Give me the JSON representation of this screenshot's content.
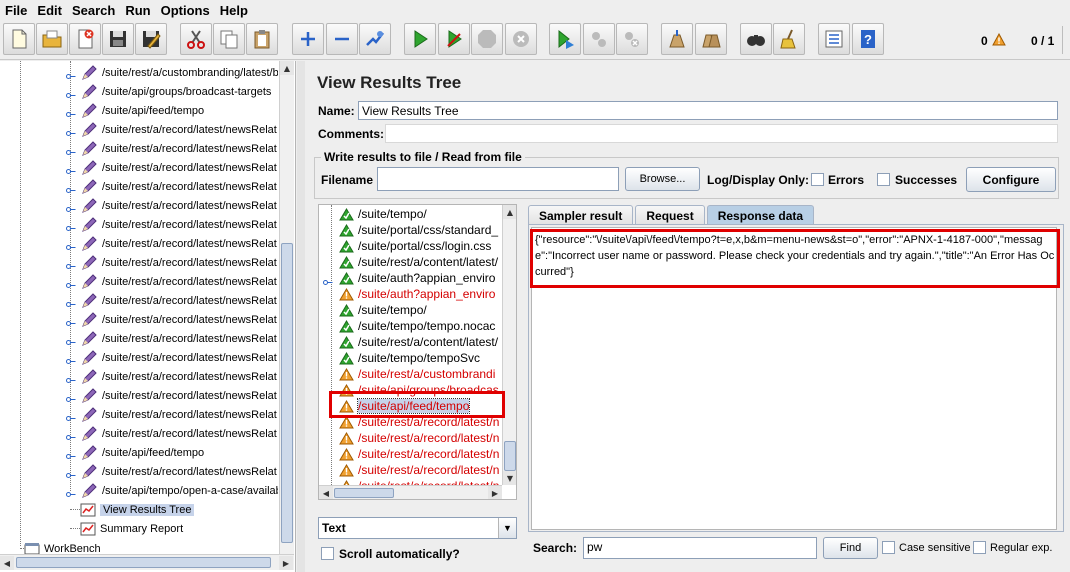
{
  "menubar": {
    "items": [
      "File",
      "Edit",
      "Search",
      "Run",
      "Options",
      "Help"
    ]
  },
  "toolbar": {
    "buttons": [
      {
        "name": "new-icon"
      },
      {
        "name": "open-icon"
      },
      {
        "name": "close-icon"
      },
      {
        "name": "save-icon"
      },
      {
        "name": "save-as-icon"
      },
      {
        "name": "cut-icon"
      },
      {
        "name": "copy-icon"
      },
      {
        "name": "paste-icon"
      },
      {
        "name": "expand-icon"
      },
      {
        "name": "collapse-icon"
      },
      {
        "name": "toggle-icon"
      },
      {
        "name": "start-icon"
      },
      {
        "name": "start-no-pause-icon"
      },
      {
        "name": "stop-icon"
      },
      {
        "name": "shutdown-icon"
      },
      {
        "name": "remote-start-icon"
      },
      {
        "name": "remote-stop-icon"
      },
      {
        "name": "remote-shutdown-icon"
      },
      {
        "name": "clear-icon"
      },
      {
        "name": "clear-all-icon"
      },
      {
        "name": "search-icon"
      },
      {
        "name": "reset-search-icon"
      },
      {
        "name": "function-helper-icon"
      },
      {
        "name": "help-icon"
      }
    ],
    "warning_count": "0",
    "thread_count": "0 / 1"
  },
  "left_tree": {
    "items": [
      {
        "label": "/suite/rest/a/custombranding/latest/b",
        "type": "sampler"
      },
      {
        "label": "/suite/api/groups/broadcast-targets",
        "type": "sampler"
      },
      {
        "label": "/suite/api/feed/tempo",
        "type": "sampler"
      },
      {
        "label": "/suite/rest/a/record/latest/newsRelat",
        "type": "sampler"
      },
      {
        "label": "/suite/rest/a/record/latest/newsRelat",
        "type": "sampler"
      },
      {
        "label": "/suite/rest/a/record/latest/newsRelat",
        "type": "sampler"
      },
      {
        "label": "/suite/rest/a/record/latest/newsRelat",
        "type": "sampler"
      },
      {
        "label": "/suite/rest/a/record/latest/newsRelat",
        "type": "sampler"
      },
      {
        "label": "/suite/rest/a/record/latest/newsRelat",
        "type": "sampler"
      },
      {
        "label": "/suite/rest/a/record/latest/newsRelat",
        "type": "sampler"
      },
      {
        "label": "/suite/rest/a/record/latest/newsRelat",
        "type": "sampler"
      },
      {
        "label": "/suite/rest/a/record/latest/newsRelat",
        "type": "sampler"
      },
      {
        "label": "/suite/rest/a/record/latest/newsRelat",
        "type": "sampler"
      },
      {
        "label": "/suite/rest/a/record/latest/newsRelat",
        "type": "sampler"
      },
      {
        "label": "/suite/rest/a/record/latest/newsRelat",
        "type": "sampler"
      },
      {
        "label": "/suite/rest/a/record/latest/newsRelat",
        "type": "sampler"
      },
      {
        "label": "/suite/rest/a/record/latest/newsRelat",
        "type": "sampler"
      },
      {
        "label": "/suite/rest/a/record/latest/newsRelat",
        "type": "sampler"
      },
      {
        "label": "/suite/rest/a/record/latest/newsRelat",
        "type": "sampler"
      },
      {
        "label": "/suite/rest/a/record/latest/newsRelat",
        "type": "sampler"
      },
      {
        "label": "/suite/api/feed/tempo",
        "type": "sampler"
      },
      {
        "label": "/suite/rest/a/record/latest/newsRelat",
        "type": "sampler"
      },
      {
        "label": "/suite/api/tempo/open-a-case/availab",
        "type": "sampler"
      },
      {
        "label": "View Results Tree",
        "type": "listener",
        "selected": true
      },
      {
        "label": "Summary Report",
        "type": "listener"
      }
    ],
    "workbench_label": "WorkBench"
  },
  "panel": {
    "title": "View Results Tree",
    "name_label": "Name:",
    "name_value": "View Results Tree",
    "comments_label": "Comments:",
    "file_group_title": "Write results to file / Read from file",
    "filename_label": "Filename",
    "browse_label": "Browse...",
    "log_display_label": "Log/Display Only:",
    "errors_label": "Errors",
    "successes_label": "Successes",
    "configure_label": "Configure"
  },
  "results": {
    "items": [
      {
        "label": "/suite/tempo/",
        "status": "ok"
      },
      {
        "label": "/suite/portal/css/standard_",
        "status": "ok"
      },
      {
        "label": "/suite/portal/css/login.css",
        "status": "ok"
      },
      {
        "label": "/suite/rest/a/content/latest/",
        "status": "ok"
      },
      {
        "label": "/suite/auth?appian_enviro",
        "status": "ok"
      },
      {
        "label": "/suite/auth?appian_enviro",
        "status": "err"
      },
      {
        "label": "/suite/tempo/",
        "status": "ok"
      },
      {
        "label": "/suite/tempo/tempo.nocac",
        "status": "ok"
      },
      {
        "label": "/suite/rest/a/content/latest/",
        "status": "ok"
      },
      {
        "label": "/suite/tempo/tempoSvc",
        "status": "ok"
      },
      {
        "label": "/suite/rest/a/custombrandi",
        "status": "err"
      },
      {
        "label": "/suite/api/groups/broadcas",
        "status": "err"
      },
      {
        "label": "/suite/api/feed/tempo",
        "status": "err",
        "selected": true
      },
      {
        "label": "/suite/rest/a/record/latest/n",
        "status": "err"
      },
      {
        "label": "/suite/rest/a/record/latest/n",
        "status": "err"
      },
      {
        "label": "/suite/rest/a/record/latest/n",
        "status": "err"
      },
      {
        "label": "/suite/rest/a/record/latest/n",
        "status": "err"
      },
      {
        "label": "/suite/rest/a/record/latest/n",
        "status": "err"
      },
      {
        "label": "/suite/rest/a/record/latest/n",
        "status": "err"
      }
    ],
    "renderer": "Text",
    "scroll_label": "Scroll automatically?"
  },
  "tabs": [
    {
      "label": "Sampler result",
      "active": false
    },
    {
      "label": "Request",
      "active": false
    },
    {
      "label": "Response data",
      "active": true
    }
  ],
  "response": {
    "text": "{\"resource\":\"\\/suite\\/api\\/feed\\/tempo?t=e,x,b&m=menu-news&st=o\",\"error\":\"APNX-1-4187-000\",\"message\":\"Incorrect user name or password. Please check your credentials and try again.\",\"title\":\"An Error Has Occurred\"}"
  },
  "search": {
    "label": "Search:",
    "value": "pw",
    "find_label": "Find",
    "case_sensitive_label": "Case sensitive",
    "regex_label": "Regular exp."
  },
  "colors": {
    "error_text": "#d40000",
    "highlight": "#e00000",
    "active_tab": "#b8cfe5",
    "selection": "#c6d3ea"
  }
}
